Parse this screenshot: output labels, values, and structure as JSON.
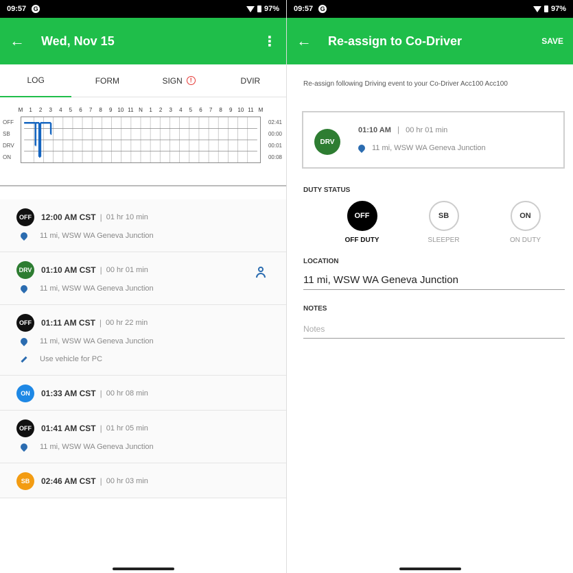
{
  "left": {
    "status": {
      "time": "09:57",
      "app_icon": "G",
      "battery": "97%"
    },
    "appbar": {
      "title": "Wed, Nov 15"
    },
    "tabs": [
      {
        "label": "LOG",
        "active": true
      },
      {
        "label": "FORM",
        "active": false
      },
      {
        "label": "SIGN",
        "active": false,
        "alert": true
      },
      {
        "label": "DVIR",
        "active": false
      }
    ],
    "graph": {
      "hour_labels": [
        "M",
        "1",
        "2",
        "3",
        "4",
        "5",
        "6",
        "7",
        "8",
        "9",
        "10",
        "11",
        "N",
        "1",
        "2",
        "3",
        "4",
        "5",
        "6",
        "7",
        "8",
        "9",
        "10",
        "11",
        "M"
      ],
      "rows": [
        "OFF",
        "SB",
        "DRV",
        "ON"
      ],
      "totals": [
        "02:41",
        "00:00",
        "00:01",
        "00:08"
      ],
      "segments": [
        {
          "status": 0,
          "start": 0.0,
          "end": 1.17
        },
        {
          "status": 2,
          "start": 1.17,
          "end": 1.18
        },
        {
          "status": 0,
          "start": 1.18,
          "end": 1.55
        },
        {
          "status": 3,
          "start": 1.55,
          "end": 1.68
        },
        {
          "status": 0,
          "start": 1.68,
          "end": 2.75
        },
        {
          "status": 1,
          "start": 2.75,
          "end": 2.8
        }
      ]
    },
    "logs": [
      {
        "badge": "OFF",
        "color": "#111111",
        "time": "12:00 AM CST",
        "duration": "01 hr 10 min",
        "location": "11 mi, WSW WA Geneva Junction"
      },
      {
        "badge": "DRV",
        "color": "#2e7d32",
        "time": "01:10 AM CST",
        "duration": "00 hr 01 min",
        "location": "11 mi, WSW WA Geneva Junction",
        "assign": true
      },
      {
        "badge": "OFF",
        "color": "#111111",
        "time": "01:11 AM CST",
        "duration": "00 hr 22 min",
        "location": "11 mi, WSW WA Geneva Junction",
        "note": "Use vehicle for PC"
      },
      {
        "badge": "ON",
        "color": "#1e88e5",
        "time": "01:33 AM CST",
        "duration": "00 hr 08 min"
      },
      {
        "badge": "OFF",
        "color": "#111111",
        "time": "01:41 AM CST",
        "duration": "01 hr 05 min",
        "location": "11 mi, WSW WA Geneva Junction"
      },
      {
        "badge": "SB",
        "color": "#f39c12",
        "time": "02:46 AM CST",
        "duration": "00 hr 03 min"
      }
    ]
  },
  "right": {
    "status": {
      "time": "09:57",
      "app_icon": "G",
      "battery": "97%"
    },
    "appbar": {
      "title": "Re-assign to Co-Driver",
      "save": "SAVE"
    },
    "instruction": "Re-assign following Driving event to your Co-Driver Acc100 Acc100",
    "event": {
      "badge": "DRV",
      "color": "#2e7d32",
      "time": "01:10 AM",
      "duration": "00 hr 01 min",
      "location": "11 mi, WSW WA Geneva Junction"
    },
    "duty_status": {
      "label": "DUTY STATUS",
      "options": [
        {
          "code": "OFF",
          "label": "OFF DUTY",
          "selected": true
        },
        {
          "code": "SB",
          "label": "SLEEPER",
          "selected": false
        },
        {
          "code": "ON",
          "label": "ON DUTY",
          "selected": false
        }
      ]
    },
    "location": {
      "label": "LOCATION",
      "value": "11 mi, WSW WA Geneva Junction"
    },
    "notes": {
      "label": "NOTES",
      "placeholder": "Notes",
      "value": ""
    }
  }
}
